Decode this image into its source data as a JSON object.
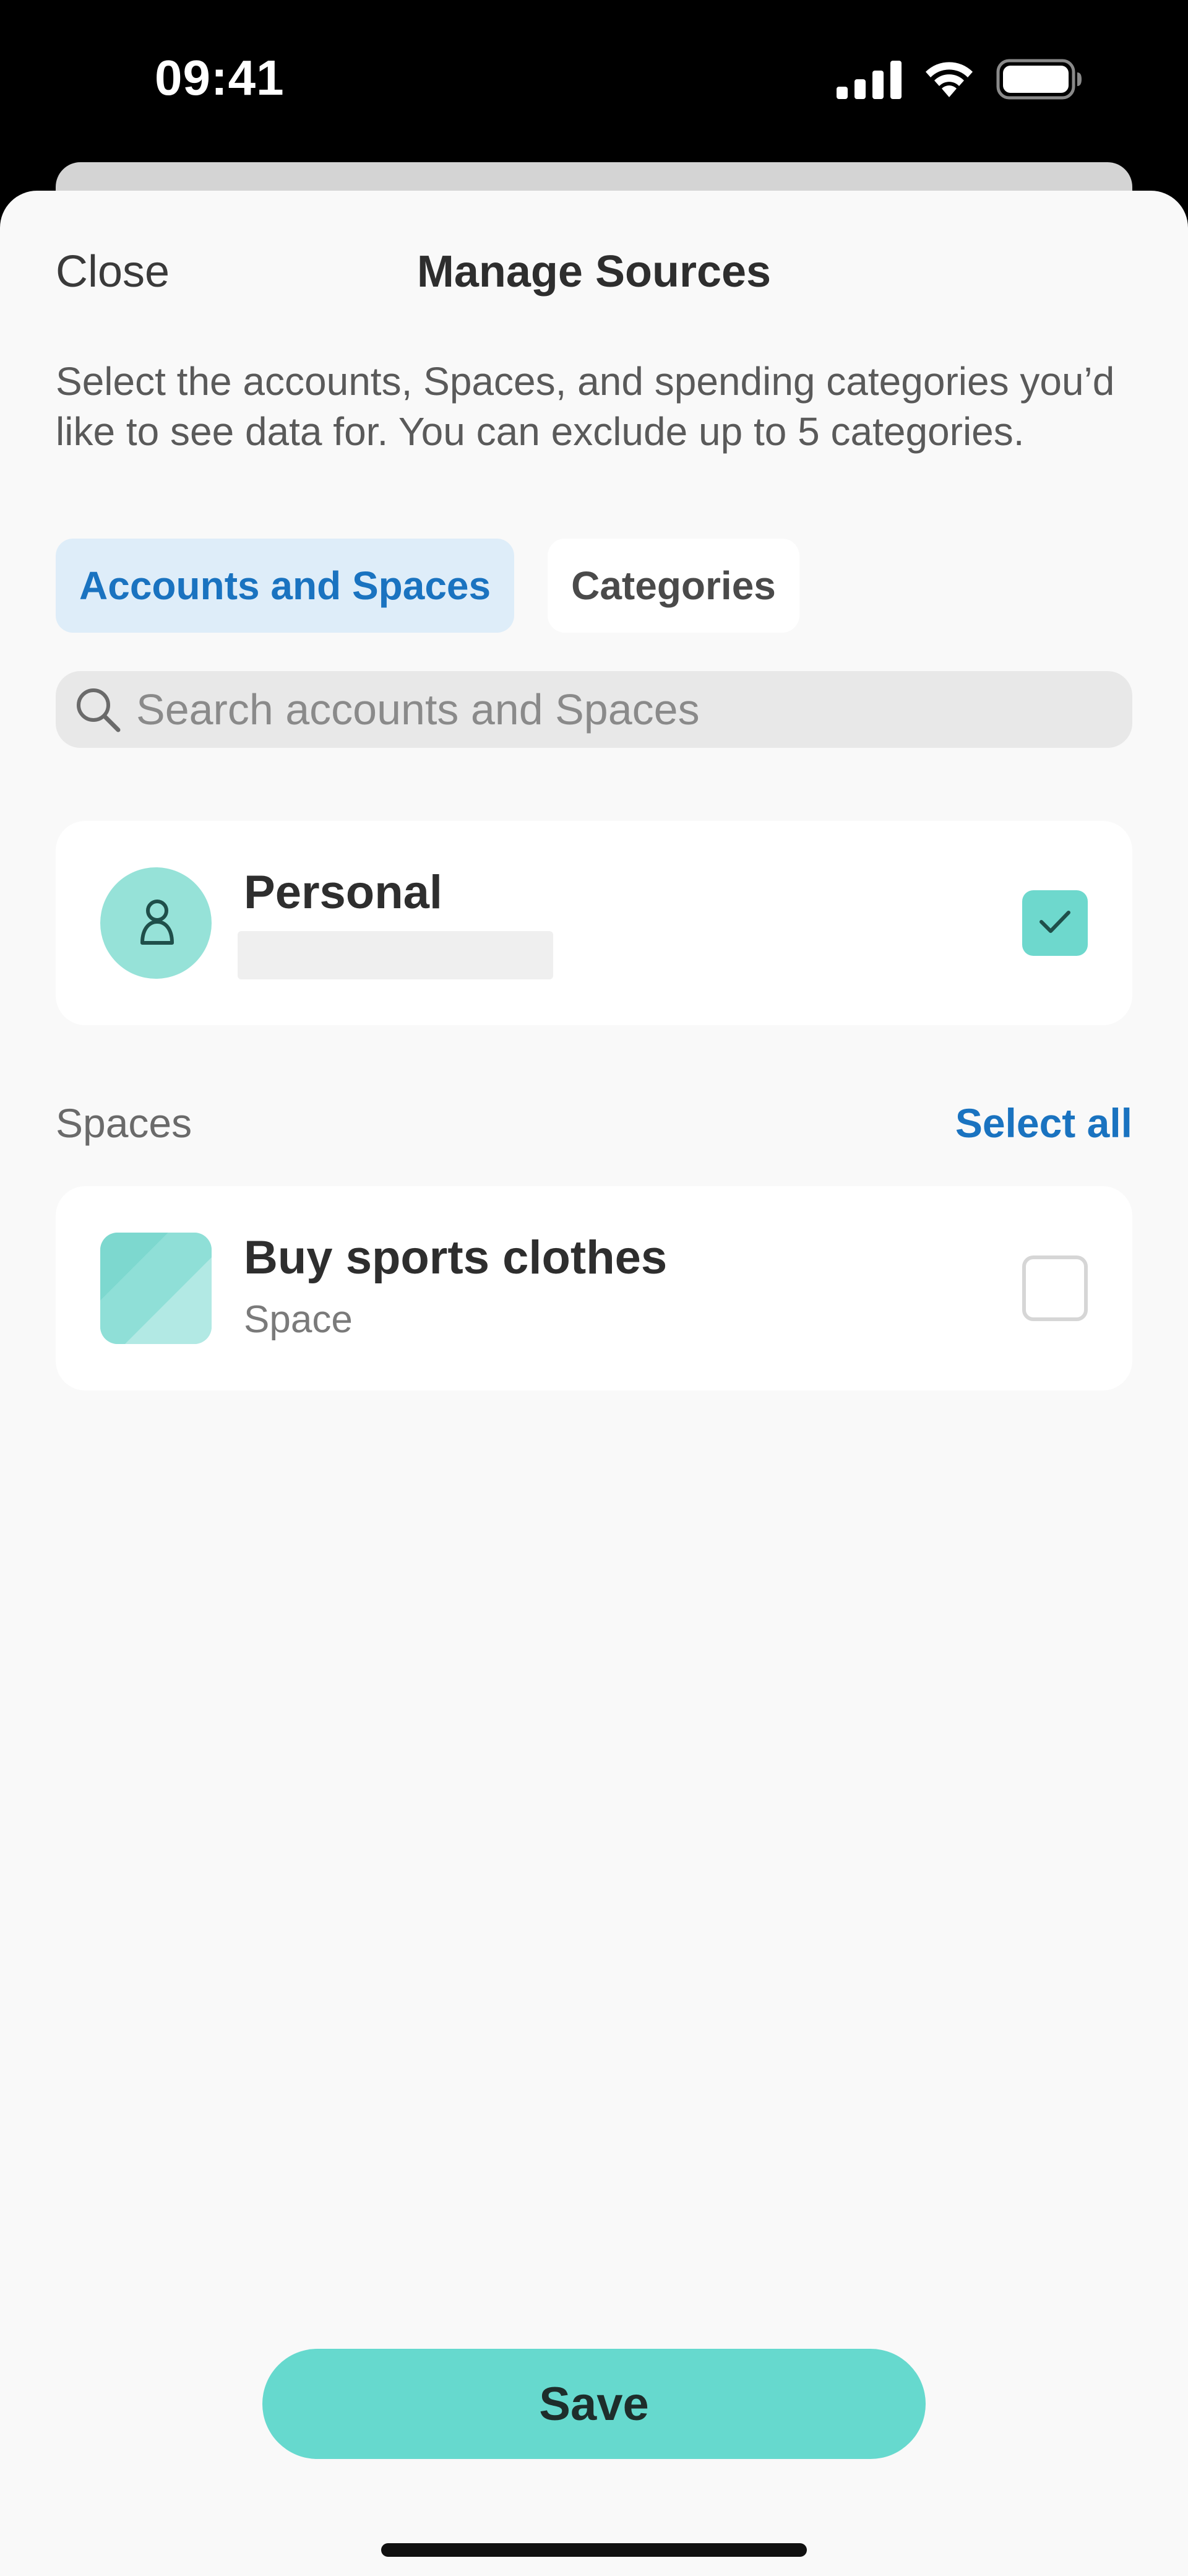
{
  "status_bar": {
    "time": "09:41",
    "icons": [
      "cellular-signal-icon",
      "wifi-icon",
      "battery-icon"
    ]
  },
  "header": {
    "close_label": "Close",
    "title": "Manage Sources"
  },
  "description": "Select the accounts, Spaces, and spending categories you’d like to see data for. You can exclude up to 5 categories.",
  "tabs": [
    {
      "label": "Accounts and Spaces",
      "active": true
    },
    {
      "label": "Categories",
      "active": false
    }
  ],
  "search": {
    "placeholder": "Search accounts and Spaces",
    "value": "",
    "icon": "search-icon"
  },
  "accounts": [
    {
      "name": "Personal",
      "icon": "person-icon",
      "checked": true
    }
  ],
  "spaces_section": {
    "label": "Spaces",
    "select_all_label": "Select all",
    "items": [
      {
        "name": "Buy sports clothes",
        "subtitle": "Space",
        "checked": false
      }
    ]
  },
  "footer": {
    "save_label": "Save"
  },
  "colors": {
    "accent_teal": "#66d9ce",
    "link_blue": "#1a73c0",
    "active_tab_bg": "#deedf9",
    "sheet_bg": "#f9f9f9"
  }
}
